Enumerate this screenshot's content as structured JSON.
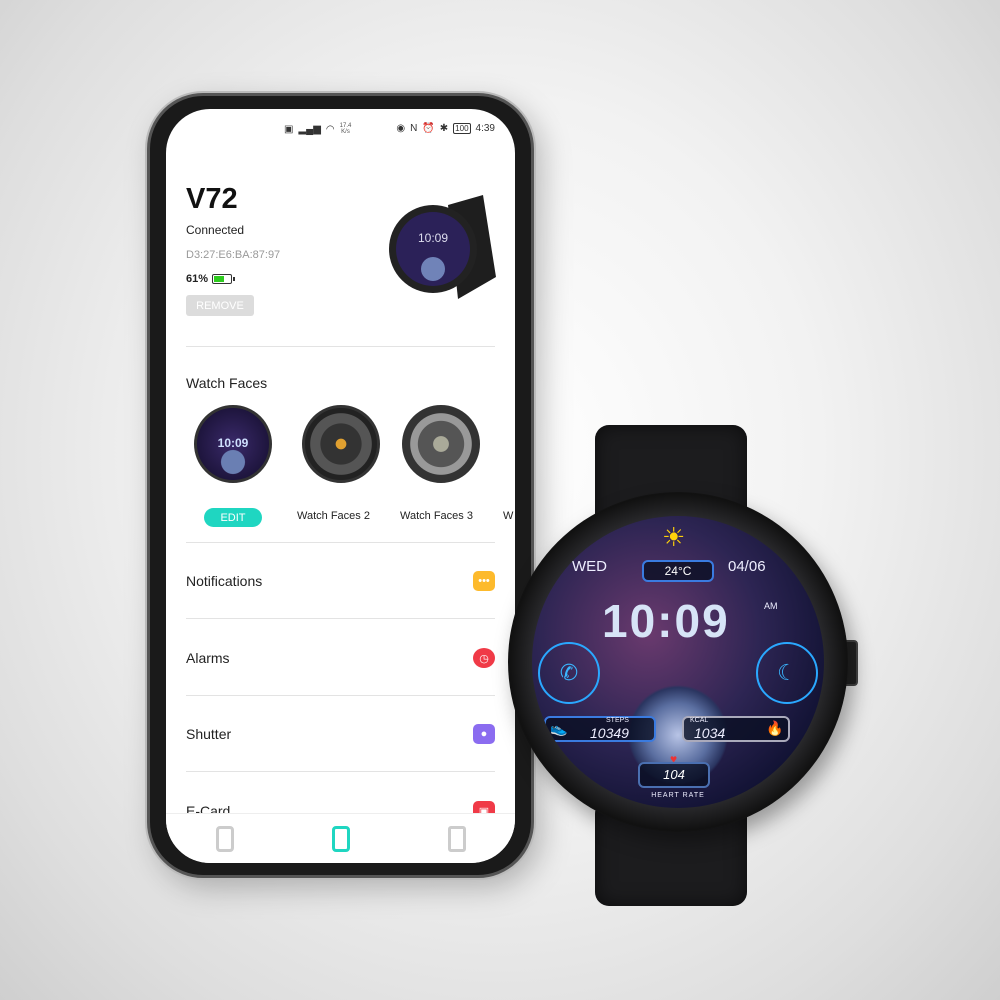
{
  "status_bar": {
    "left_icons": [
      "hd-icon",
      "signal-4g-icon",
      "wifi-icon"
    ],
    "speed": "17.4",
    "speed_unit": "K/s",
    "right_icons": [
      "eye-icon",
      "nfc-icon",
      "alarm-icon",
      "bluetooth-icon"
    ],
    "battery": "100",
    "time": "4:39"
  },
  "device": {
    "name": "V72",
    "status": "Connected",
    "mac": "D3:27:E6:BA:87:97",
    "battery_percent": "61%",
    "battery_level": 0.61,
    "remove_label": "REMOVE"
  },
  "watch_faces": {
    "title": "Watch Faces",
    "edit_label": "EDIT",
    "thumb_time": "10:09",
    "items": [
      {
        "label": "Watch Faces 2"
      },
      {
        "label": "Watch Faces 3"
      },
      {
        "label": "W"
      }
    ]
  },
  "menu": [
    {
      "label": "Notifications",
      "icon": "chat-bubble-icon",
      "color": "#FDBA2C",
      "glyph": "•••"
    },
    {
      "label": "Alarms",
      "icon": "clock-icon",
      "color": "#F03A47",
      "glyph": "◷"
    },
    {
      "label": "Shutter",
      "icon": "camera-icon",
      "color": "#8B6CF0",
      "glyph": "●"
    },
    {
      "label": "E-Card",
      "icon": "id-card-icon",
      "color": "#F03A47",
      "glyph": "▣"
    }
  ],
  "nav": [
    {
      "icon": "home-icon",
      "active": false
    },
    {
      "icon": "watch-icon",
      "active": true
    },
    {
      "icon": "profile-icon",
      "active": false
    }
  ],
  "accent": "#1FD6C1",
  "watch_display": {
    "day": "WED",
    "date": "04/06",
    "temperature": "24°C",
    "time": "10:09",
    "ampm": "AM",
    "steps_label": "STEPS",
    "steps": "10349",
    "kcal_label": "KCAL",
    "kcal": "1034",
    "heart_rate": "104",
    "heart_rate_label": "HEART RATE"
  }
}
